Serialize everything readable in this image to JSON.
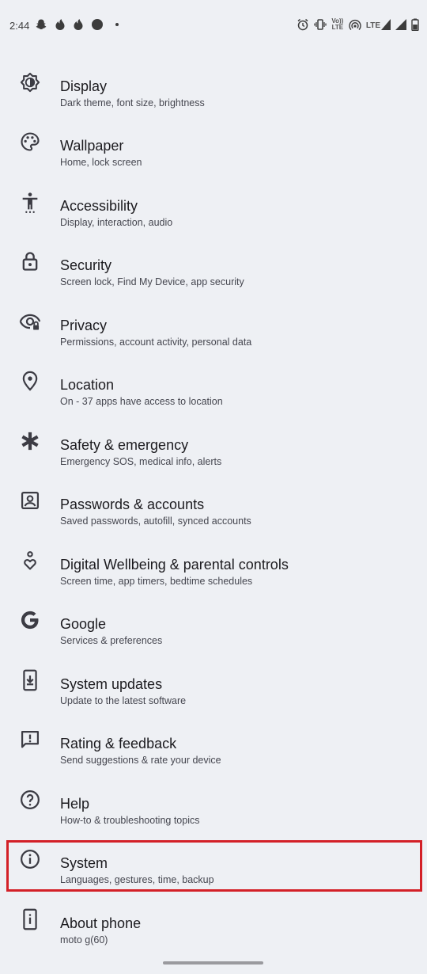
{
  "status_bar": {
    "time": "2:44",
    "left_icons": [
      "snapchat-icon",
      "tinder-icon",
      "tinder-icon",
      "circle-icon",
      "dot-icon"
    ],
    "right_icons": [
      "alarm-icon",
      "vibrate-icon",
      "volte-icon",
      "hotspot-icon",
      "lte-signal-icon",
      "signal-icon",
      "battery-icon"
    ],
    "volte_label": "Vo)) LTE",
    "lte_label": "LTE"
  },
  "settings": [
    {
      "title": "Display",
      "subtitle": "Dark theme, font size, brightness",
      "icon": "display-icon"
    },
    {
      "title": "Wallpaper",
      "subtitle": "Home, lock screen",
      "icon": "palette-icon"
    },
    {
      "title": "Accessibility",
      "subtitle": "Display, interaction, audio",
      "icon": "accessibility-icon"
    },
    {
      "title": "Security",
      "subtitle": "Screen lock, Find My Device, app security",
      "icon": "lock-icon"
    },
    {
      "title": "Privacy",
      "subtitle": "Permissions, account activity, personal data",
      "icon": "privacy-eye-icon"
    },
    {
      "title": "Location",
      "subtitle": "On - 37 apps have access to location",
      "icon": "location-pin-icon"
    },
    {
      "title": "Safety & emergency",
      "subtitle": "Emergency SOS, medical info, alerts",
      "icon": "asterisk-icon"
    },
    {
      "title": "Passwords & accounts",
      "subtitle": "Saved passwords, autofill, synced accounts",
      "icon": "account-box-icon"
    },
    {
      "title": "Digital Wellbeing & parental controls",
      "subtitle": "Screen time, app timers, bedtime schedules",
      "icon": "wellbeing-icon"
    },
    {
      "title": "Google",
      "subtitle": "Services & preferences",
      "icon": "google-g-icon"
    },
    {
      "title": "System updates",
      "subtitle": "Update to the latest software",
      "icon": "system-update-icon"
    },
    {
      "title": "Rating & feedback",
      "subtitle": "Send suggestions & rate your device",
      "icon": "feedback-icon"
    },
    {
      "title": "Help",
      "subtitle": "How-to & troubleshooting topics",
      "icon": "help-icon"
    },
    {
      "title": "System",
      "subtitle": "Languages, gestures, time, backup",
      "icon": "info-icon",
      "highlighted": true
    },
    {
      "title": "About phone",
      "subtitle": "moto g(60)",
      "icon": "phone-info-icon"
    }
  ],
  "colors": {
    "background": "#eef0f4",
    "highlight_border": "#d32027",
    "icon": "#3c3c44"
  }
}
